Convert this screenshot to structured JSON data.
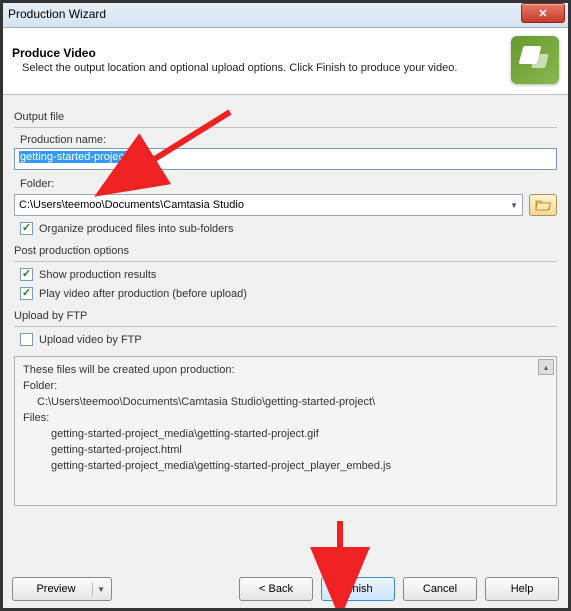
{
  "window": {
    "title": "Production Wizard"
  },
  "header": {
    "title": "Produce Video",
    "desc": "Select the output location and optional upload options. Click Finish to produce your video."
  },
  "output": {
    "group_label": "Output file",
    "name_label": "Production name:",
    "name_value": "getting-started-project",
    "folder_label": "Folder:",
    "folder_value": "C:\\Users\\teemoo\\Documents\\Camtasia Studio",
    "organize_label": "Organize produced files into sub-folders"
  },
  "post": {
    "group_label": "Post production options",
    "show_results_label": "Show production results",
    "play_after_label": "Play video after production (before upload)"
  },
  "ftp": {
    "group_label": "Upload by FTP",
    "upload_label": "Upload video by FTP"
  },
  "files": {
    "intro": "These files will be created upon production:",
    "folder_label": "Folder:",
    "folder_path": "C:\\Users\\teemoo\\Documents\\Camtasia Studio\\getting-started-project\\",
    "files_label": "Files:",
    "list": [
      "getting-started-project_media\\getting-started-project.gif",
      "getting-started-project.html",
      "getting-started-project_media\\getting-started-project_player_embed.js"
    ]
  },
  "buttons": {
    "preview": "Preview",
    "back": "< Back",
    "finish": "Finish",
    "cancel": "Cancel",
    "help": "Help"
  }
}
